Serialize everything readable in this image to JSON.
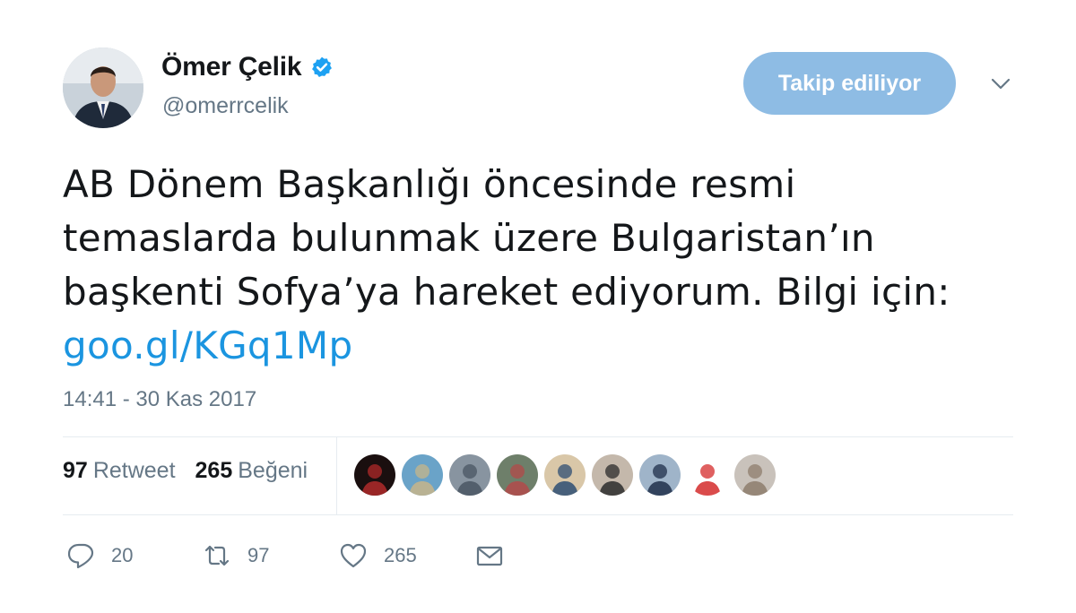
{
  "author": {
    "display_name": "Ömer Çelik",
    "handle": "@omerrcelik",
    "verified": true,
    "avatar_icon": "person-photo"
  },
  "follow_button": {
    "label": "Takip ediliyor"
  },
  "tweet": {
    "lines": [
      "AB Dönem Başkanlığı öncesinde resmi",
      "temaslarda bulunmak üzere Bulgaristan’ın",
      "başkenti Sofya’ya hareket ediyorum. Bilgi için:"
    ],
    "link": "goo.gl/KGq1Mp"
  },
  "timestamp": "14:41 - 30 Kas 2017",
  "stats": {
    "retweets": {
      "count": "97",
      "label": "Retweet"
    },
    "likes": {
      "count": "265",
      "label": "Beğeni"
    }
  },
  "liker_avatars": [
    {
      "color": "#1a0f0f",
      "accent": "#b02a2a"
    },
    {
      "color": "#6aa3c8",
      "accent": "#c7b58a"
    },
    {
      "color": "#8894a0",
      "accent": "#4a5663"
    },
    {
      "color": "#6e7f6a",
      "accent": "#b34a4a"
    },
    {
      "color": "#d9c7a8",
      "accent": "#2d4e73"
    },
    {
      "color": "#c4b8ab",
      "accent": "#2b2b2b"
    },
    {
      "color": "#9fb4c9",
      "accent": "#1f2f4a"
    },
    {
      "color": "#ffffff",
      "accent": "#d42b2b"
    },
    {
      "color": "#c9c2bb",
      "accent": "#8d7c6c"
    }
  ],
  "actions": {
    "reply": {
      "icon": "reply-icon",
      "count": "20"
    },
    "retweet": {
      "icon": "retweet-icon",
      "count": "97"
    },
    "like": {
      "icon": "heart-icon",
      "count": "265"
    },
    "message": {
      "icon": "envelope-icon"
    }
  },
  "colors": {
    "accent": "#1b95e0",
    "follow_button_bg": "#8ebce4",
    "muted_text": "#657786",
    "verified_badge": "#1da1f2"
  }
}
